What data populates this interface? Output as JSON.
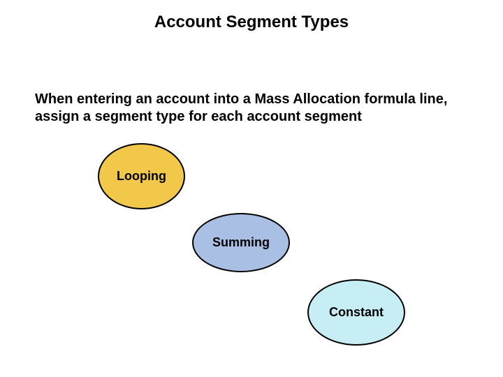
{
  "title": "Account Segment Types",
  "body": "When entering an account into a Mass Allocation formula line, assign a segment type for each account segment",
  "ellipses": {
    "looping": "Looping",
    "summing": "Summing",
    "constant": "Constant"
  }
}
